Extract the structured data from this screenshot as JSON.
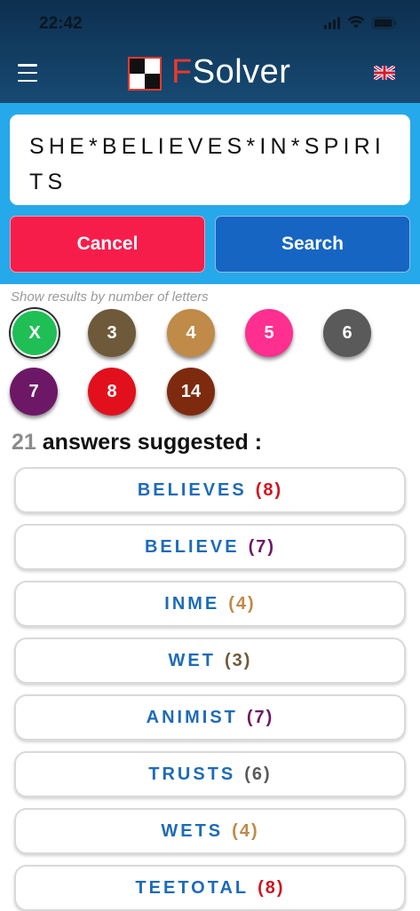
{
  "status": {
    "time": "22:42"
  },
  "header": {
    "title_first": "F",
    "title_rest": "Solver"
  },
  "search": {
    "query": "SHE*BELIEVES*IN*SPIRITS",
    "cancel_label": "Cancel",
    "search_label": "Search"
  },
  "filters": {
    "hint": "Show results by number of letters",
    "items": [
      {
        "label": "X",
        "color": "#1fbf55",
        "active": true
      },
      {
        "label": "3",
        "color": "#6e5a3a"
      },
      {
        "label": "4",
        "color": "#c08a48"
      },
      {
        "label": "5",
        "color": "#ff2f90"
      },
      {
        "label": "6",
        "color": "#5a5a5a"
      },
      {
        "label": "7",
        "color": "#6d1866"
      },
      {
        "label": "8",
        "color": "#e2101c"
      },
      {
        "label": "14",
        "color": "#7e2a0e"
      }
    ]
  },
  "results": {
    "count": "21",
    "label": "answers suggested :",
    "items": [
      {
        "word": "BELIEVES",
        "len": "(8)",
        "len_color": "#d0141e"
      },
      {
        "word": "BELIEVE",
        "len": "(7)",
        "len_color": "#6d1866"
      },
      {
        "word": "INME",
        "len": "(4)",
        "len_color": "#c08a48"
      },
      {
        "word": "WET",
        "len": "(3)",
        "len_color": "#6e5a3a"
      },
      {
        "word": "ANIMIST",
        "len": "(7)",
        "len_color": "#6d1866"
      },
      {
        "word": "TRUSTS",
        "len": "(6)",
        "len_color": "#5a5a5a"
      },
      {
        "word": "WETS",
        "len": "(4)",
        "len_color": "#c08a48"
      },
      {
        "word": "TEETOTAL",
        "len": "(8)",
        "len_color": "#d0141e"
      }
    ]
  }
}
